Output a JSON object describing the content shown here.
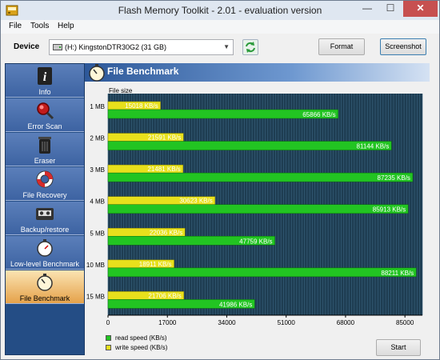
{
  "window": {
    "title": "Flash Memory Toolkit - 2.01 - evaluation version",
    "controls": {
      "minimize": "—",
      "maximize": "☐",
      "close": "✕"
    }
  },
  "menu": {
    "items": [
      "File",
      "Tools",
      "Help"
    ]
  },
  "device_bar": {
    "label": "Device",
    "selected_device": "(H:) KingstonDTR30G2 (31 GB)",
    "format_label": "Format",
    "screenshot_label": "Screenshot"
  },
  "sidebar": {
    "items": [
      {
        "label": "Info",
        "icon": "info-icon",
        "active": false
      },
      {
        "label": "Error Scan",
        "icon": "magnifier-icon",
        "active": false
      },
      {
        "label": "Eraser",
        "icon": "trash-icon",
        "active": false
      },
      {
        "label": "File Recovery",
        "icon": "lifebuoy-icon",
        "active": false
      },
      {
        "label": "Backup/restore",
        "icon": "tape-icon",
        "active": false
      },
      {
        "label": "Low-level Benchmark",
        "icon": "stopwatch-icon",
        "active": false
      },
      {
        "label": "File Benchmark",
        "icon": "stopwatch-icon",
        "active": true
      }
    ]
  },
  "panel": {
    "title": "File Benchmark",
    "start_label": "Start"
  },
  "colors": {
    "read": "#22c422",
    "write": "#e8e01c",
    "plot_background": "#1e3d52",
    "sidebar": "#244d85",
    "active_item": "#f2c77c"
  },
  "chart_data": {
    "type": "bar",
    "orientation": "horizontal",
    "ylabel": "File size",
    "categories": [
      "1 MB",
      "2 MB",
      "3 MB",
      "4 MB",
      "5 MB",
      "10 MB",
      "15 MB"
    ],
    "series": [
      {
        "name": "write speed (KB/s)",
        "values": [
          15018,
          21591,
          21481,
          30623,
          22036,
          18911,
          21706
        ],
        "labels": [
          "15018 KB/s",
          "21591 KB/s",
          "21481 KB/s",
          "30623 KB/s",
          "22036 KB/s",
          "18911 KB/s",
          "21706 KB/s"
        ]
      },
      {
        "name": "read speed (KB/s)",
        "values": [
          65866,
          81144,
          87235,
          85913,
          47759,
          88211,
          41986
        ],
        "labels": [
          "65866 KB/s",
          "81144 KB/s",
          "87235 KB/s",
          "85913 KB/s",
          "47759 KB/s",
          "88211 KB/s",
          "41986 KB/s"
        ]
      }
    ],
    "xlim": [
      0,
      90000
    ],
    "x_ticks": [
      0,
      17000,
      34000,
      51000,
      68000,
      85000
    ],
    "legend": [
      "read speed (KB/s)",
      "write speed (KB/s)"
    ],
    "legend_position": "bottom-left",
    "grid": true
  }
}
